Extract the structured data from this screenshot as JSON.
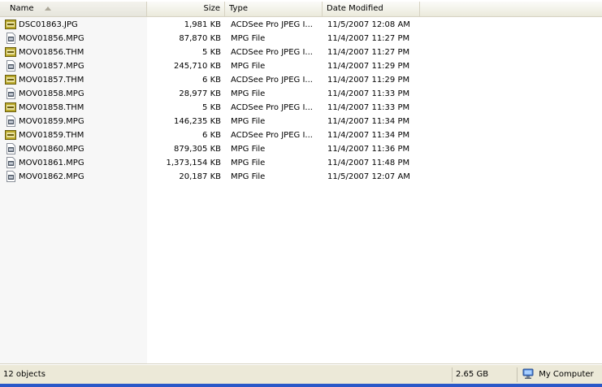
{
  "columns": {
    "name": "Name",
    "size": "Size",
    "type": "Type",
    "date": "Date Modified"
  },
  "files": [
    {
      "name": "DSC01863.JPG",
      "size": "1,981 KB",
      "type": "ACDSee Pro JPEG I...",
      "date": "11/5/2007 12:08 AM",
      "icon": "jpg-icon"
    },
    {
      "name": "MOV01856.MPG",
      "size": "87,870 KB",
      "type": "MPG File",
      "date": "11/4/2007 11:27 PM",
      "icon": "mpg-icon"
    },
    {
      "name": "MOV01856.THM",
      "size": "5 KB",
      "type": "ACDSee Pro JPEG I...",
      "date": "11/4/2007 11:27 PM",
      "icon": "jpg-icon"
    },
    {
      "name": "MOV01857.MPG",
      "size": "245,710 KB",
      "type": "MPG File",
      "date": "11/4/2007 11:29 PM",
      "icon": "mpg-icon"
    },
    {
      "name": "MOV01857.THM",
      "size": "6 KB",
      "type": "ACDSee Pro JPEG I...",
      "date": "11/4/2007 11:29 PM",
      "icon": "jpg-icon"
    },
    {
      "name": "MOV01858.MPG",
      "size": "28,977 KB",
      "type": "MPG File",
      "date": "11/4/2007 11:33 PM",
      "icon": "mpg-icon"
    },
    {
      "name": "MOV01858.THM",
      "size": "5 KB",
      "type": "ACDSee Pro JPEG I...",
      "date": "11/4/2007 11:33 PM",
      "icon": "jpg-icon"
    },
    {
      "name": "MOV01859.MPG",
      "size": "146,235 KB",
      "type": "MPG File",
      "date": "11/4/2007 11:34 PM",
      "icon": "mpg-icon"
    },
    {
      "name": "MOV01859.THM",
      "size": "6 KB",
      "type": "ACDSee Pro JPEG I...",
      "date": "11/4/2007 11:34 PM",
      "icon": "jpg-icon"
    },
    {
      "name": "MOV01860.MPG",
      "size": "879,305 KB",
      "type": "MPG File",
      "date": "11/4/2007 11:36 PM",
      "icon": "mpg-icon"
    },
    {
      "name": "MOV01861.MPG",
      "size": "1,373,154 KB",
      "type": "MPG File",
      "date": "11/4/2007 11:48 PM",
      "icon": "mpg-icon"
    },
    {
      "name": "MOV01862.MPG",
      "size": "20,187 KB",
      "type": "MPG File",
      "date": "11/5/2007 12:07 AM",
      "icon": "mpg-icon"
    }
  ],
  "status": {
    "objects": "12 objects",
    "size": "2.65 GB",
    "zone": "My Computer",
    "zone_icon": "computer-icon"
  },
  "colors": {
    "jpg_icon": "#b9a82a",
    "mpg_icon": "#8a8f99",
    "status_bar": "#ece9d8",
    "taskbar": "#2a58c8"
  }
}
